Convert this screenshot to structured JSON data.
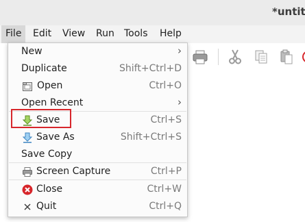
{
  "window": {
    "title": "*untitl"
  },
  "menubar": [
    "File",
    "Edit",
    "View",
    "Run",
    "Tools",
    "Help"
  ],
  "file_menu": {
    "new": {
      "label": "New"
    },
    "duplicate": {
      "label": "Duplicate",
      "accel": "Shift+Ctrl+D"
    },
    "open": {
      "label": "Open",
      "accel": "Ctrl+O"
    },
    "open_recent": {
      "label": "Open Recent"
    },
    "save": {
      "label": "Save",
      "accel": "Ctrl+S"
    },
    "save_as": {
      "label": "Save As",
      "accel": "Shift+Ctrl+S"
    },
    "save_copy": {
      "label": "Save Copy"
    },
    "screen_capture": {
      "label": "Screen Capture",
      "accel": "Ctrl+P"
    },
    "close": {
      "label": "Close",
      "accel": "Ctrl+W"
    },
    "quit": {
      "label": "Quit",
      "accel": "Ctrl+Q"
    }
  },
  "icons": {
    "open": "folder-open-icon",
    "save": "save-arrow-icon",
    "save_as": "save-as-arrow-icon",
    "screen_capture": "printer-icon",
    "close": "close-circle-icon",
    "quit": "close-x-icon"
  },
  "colors": {
    "close_red": "#d7262b",
    "save_green": "#8dc63f",
    "save_as_blue": "#6fb3e8",
    "highlight": "#d7262b"
  }
}
